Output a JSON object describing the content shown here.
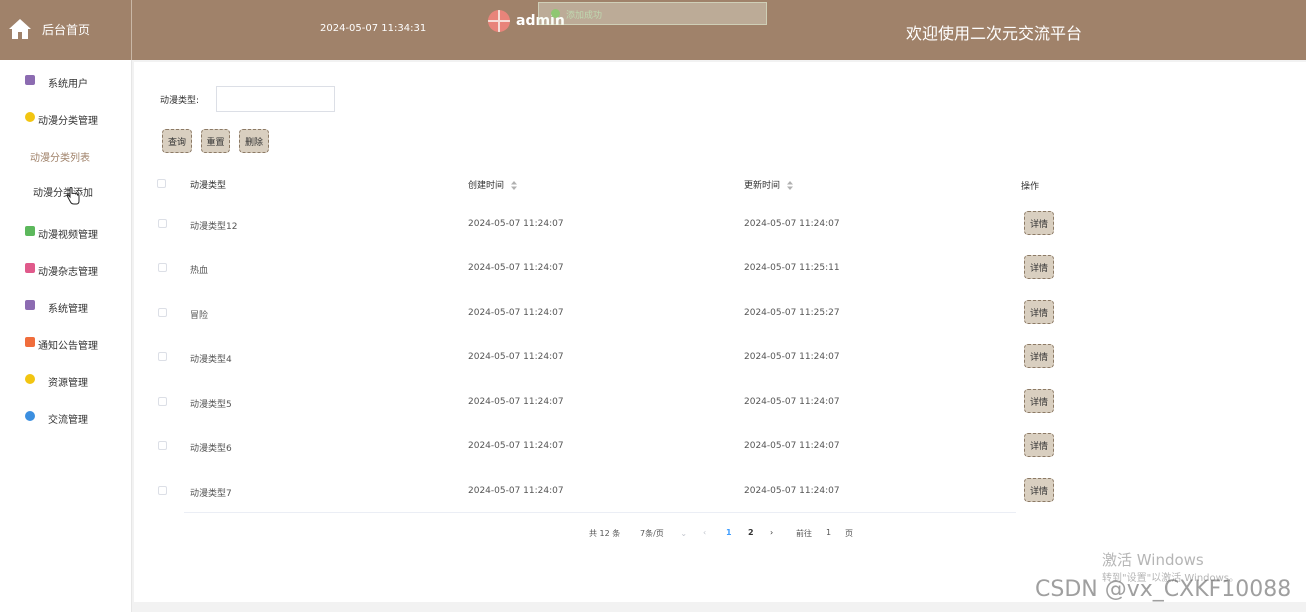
{
  "header": {
    "home_label": "后台首页",
    "datetime": "2024-05-07 11:34:31",
    "username": "admin",
    "welcome": "欢迎使用二次元交流平台",
    "toast": "添加成功"
  },
  "sidebar": {
    "items": [
      {
        "label": "系统用户",
        "icon": "archive-icon",
        "color": "#8c6bb1"
      },
      {
        "label": "动漫分类管理",
        "icon": "hexagon-icon",
        "color": "#f2c511"
      },
      {
        "label": "动漫视频管理",
        "icon": "chat-icon",
        "color": "#5cb85c"
      },
      {
        "label": "动漫杂志管理",
        "icon": "document-icon",
        "color": "#e05a8b"
      },
      {
        "label": "系统管理",
        "icon": "archive-icon",
        "color": "#8c6bb1"
      },
      {
        "label": "通知公告管理",
        "icon": "grid-icon",
        "color": "#f06d3c"
      },
      {
        "label": "资源管理",
        "icon": "hexagon-icon",
        "color": "#f2c511"
      },
      {
        "label": "交流管理",
        "icon": "star-icon",
        "color": "#3b8fe0"
      }
    ],
    "subitems": [
      {
        "label": "动漫分类列表",
        "active": true
      },
      {
        "label": "动漫分类添加",
        "active": false
      }
    ]
  },
  "search": {
    "label": "动漫类型:",
    "value": "",
    "placeholder": ""
  },
  "buttons": {
    "query": "查询",
    "reset": "重置",
    "delete": "删除"
  },
  "table": {
    "columns": [
      "动漫类型",
      "创建时间",
      "更新时间",
      "操作"
    ],
    "detail_label": "详情",
    "rows": [
      {
        "type": "动漫类型12",
        "created": "2024-05-07 11:24:07",
        "updated": "2024-05-07 11:24:07"
      },
      {
        "type": "热血",
        "created": "2024-05-07 11:24:07",
        "updated": "2024-05-07 11:25:11"
      },
      {
        "type": "冒险",
        "created": "2024-05-07 11:24:07",
        "updated": "2024-05-07 11:25:27"
      },
      {
        "type": "动漫类型4",
        "created": "2024-05-07 11:24:07",
        "updated": "2024-05-07 11:24:07"
      },
      {
        "type": "动漫类型5",
        "created": "2024-05-07 11:24:07",
        "updated": "2024-05-07 11:24:07"
      },
      {
        "type": "动漫类型6",
        "created": "2024-05-07 11:24:07",
        "updated": "2024-05-07 11:24:07"
      },
      {
        "type": "动漫类型7",
        "created": "2024-05-07 11:24:07",
        "updated": "2024-05-07 11:24:07"
      }
    ]
  },
  "pagination": {
    "total": "共 12 条",
    "page_size": "7条/页",
    "pages": [
      "1",
      "2"
    ],
    "current_page": "1",
    "goto_label": "前往",
    "goto_value": "1",
    "page_suffix": "页"
  },
  "watermark": {
    "activate": "激活 Windows",
    "activate_hint": "转到\"设置\"以激活 Windows。",
    "csdn": "CSDN @vx_CXKF10088"
  },
  "colors": {
    "header_bg": "#a0826a",
    "button_bg": "#d9cfc0",
    "active_sub": "#a0826a",
    "page_active": "#409eff"
  }
}
